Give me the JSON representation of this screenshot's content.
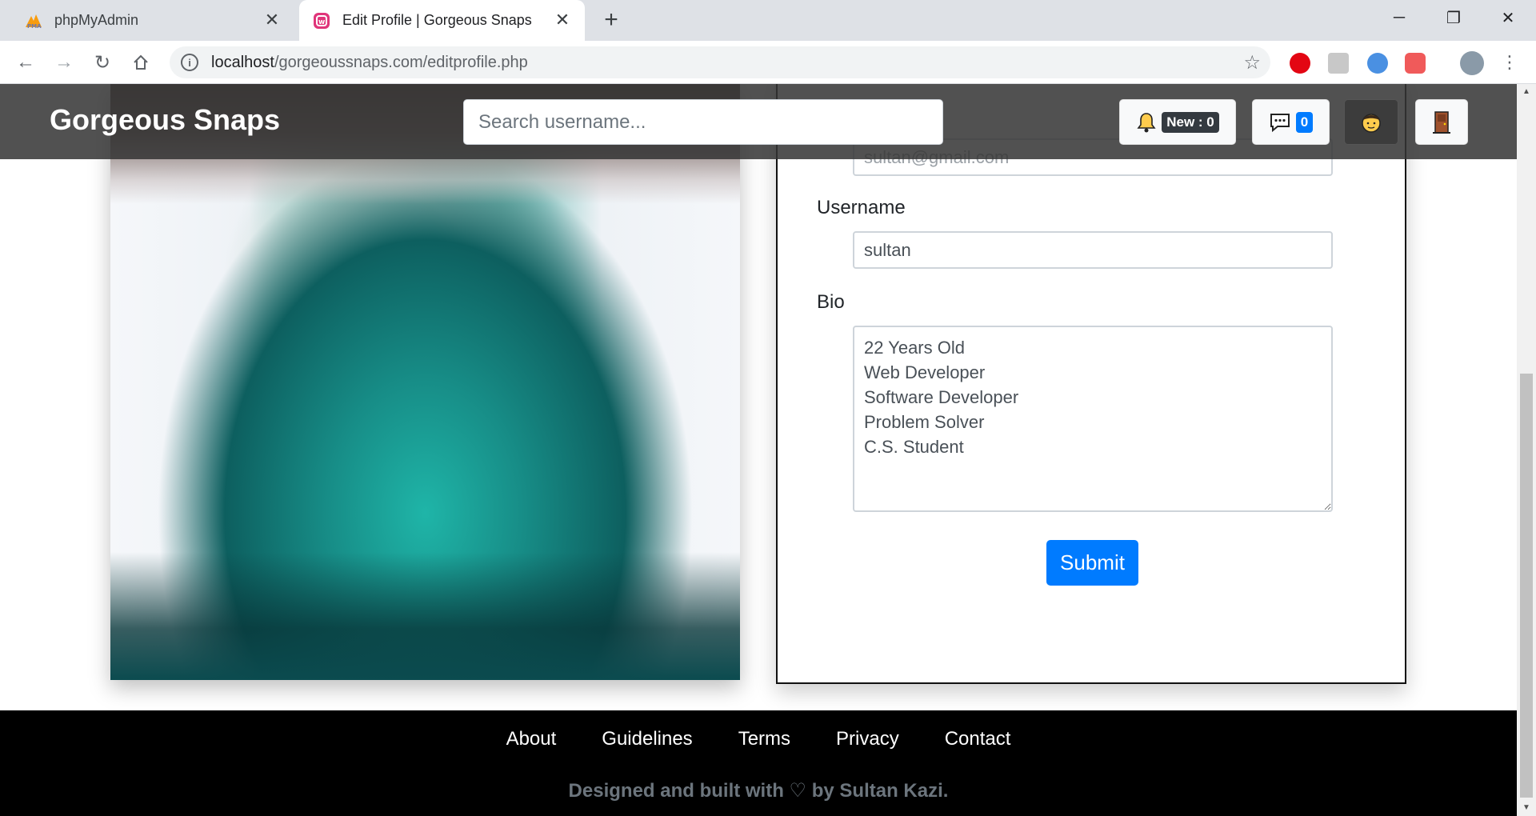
{
  "browser": {
    "tabs": [
      {
        "title": "phpMyAdmin",
        "active": false
      },
      {
        "title": "Edit Profile | Gorgeous Snaps",
        "active": true
      }
    ],
    "url_host": "localhost",
    "url_path": "/gorgeoussnaps.com/editprofile.php",
    "icons": {
      "back": "back-arrow-icon",
      "forward": "forward-arrow-icon",
      "reload": "reload-icon",
      "home": "home-icon",
      "bookmark": "star-icon"
    }
  },
  "navbar": {
    "brand": "Gorgeous Snaps",
    "search_placeholder": "Search username...",
    "notifications_label": "New : 0",
    "messages_count": "0"
  },
  "form": {
    "email_value": "sultan@gmail.com",
    "username_label": "Username",
    "username_value": "sultan",
    "bio_label": "Bio",
    "bio_value": "22 Years Old\nWeb Developer\nSoftware Developer\nProblem Solver\nC.S. Student",
    "submit_label": "Submit"
  },
  "footer": {
    "links": [
      "About",
      "Guidelines",
      "Terms",
      "Privacy",
      "Contact"
    ],
    "credit": "Designed and built with ♡ by Sultan Kazi."
  },
  "colors": {
    "primary": "#007bff",
    "navbar_bg": "#343434",
    "footer_bg": "#000000"
  }
}
